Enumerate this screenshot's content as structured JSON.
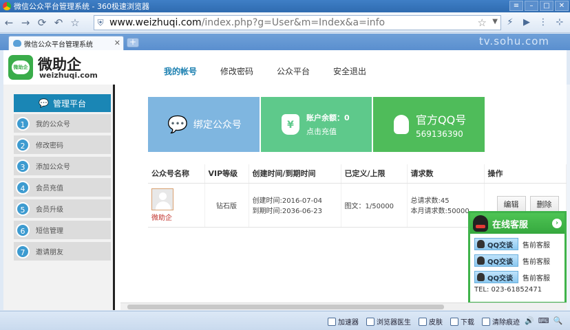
{
  "window": {
    "title": "微信公众平台管理系统 - 360极速浏览器"
  },
  "browser": {
    "url_host": "www.weizhuqi.com",
    "url_path": "/index.php?g=User&m=Index&a=info",
    "tab_title": "微信公众平台管理系统",
    "watermark": "tv.sohu.com"
  },
  "header": {
    "logo_text": "微助企",
    "logo_sub": "weizhuqi.com",
    "logo_badge": "微助企",
    "nav": [
      {
        "label": "我的帐号"
      },
      {
        "label": "修改密码"
      },
      {
        "label": "公众平台"
      },
      {
        "label": "安全退出"
      }
    ]
  },
  "sidebar": {
    "heading": "管理平台",
    "items": [
      {
        "num": "1",
        "label": "我的公众号"
      },
      {
        "num": "2",
        "label": "修改密码"
      },
      {
        "num": "3",
        "label": "添加公众号"
      },
      {
        "num": "4",
        "label": "会员充值"
      },
      {
        "num": "5",
        "label": "会员升级"
      },
      {
        "num": "6",
        "label": "短信管理"
      },
      {
        "num": "7",
        "label": "邀请朋友"
      }
    ]
  },
  "cards": {
    "bind": "绑定公众号",
    "balance_line1": "账户余额：0",
    "balance_line2": "点击充值",
    "bag_symbol": "¥",
    "qq_title": "官方QQ号",
    "qq_number": "569136390"
  },
  "table": {
    "headers": [
      "公众号名称",
      "VIP等级",
      "创建时间/到期时间",
      "已定义/上限",
      "请求数",
      "操作"
    ],
    "row": {
      "name": "微助企",
      "vip": "钻石版",
      "created": "创建时间:2016-07-04",
      "expires": "到期时间:2036-06-23",
      "defined": "图文：1/50000",
      "req_total": "总请求数:45",
      "req_month": "本月请求数:50000",
      "edit": "编辑",
      "delete": "删除"
    }
  },
  "service": {
    "title": "在线客服",
    "rows": [
      {
        "btn": "QQ交谈",
        "label": "售前客服"
      },
      {
        "btn": "QQ交谈",
        "label": "售前客服"
      },
      {
        "btn": "QQ交谈",
        "label": "售前客服"
      }
    ],
    "tel": "TEL: 023-61852471"
  },
  "statusbar": {
    "items": [
      "加速器",
      "浏览器医生",
      "皮肤",
      "下载",
      "清除痕迹"
    ]
  }
}
